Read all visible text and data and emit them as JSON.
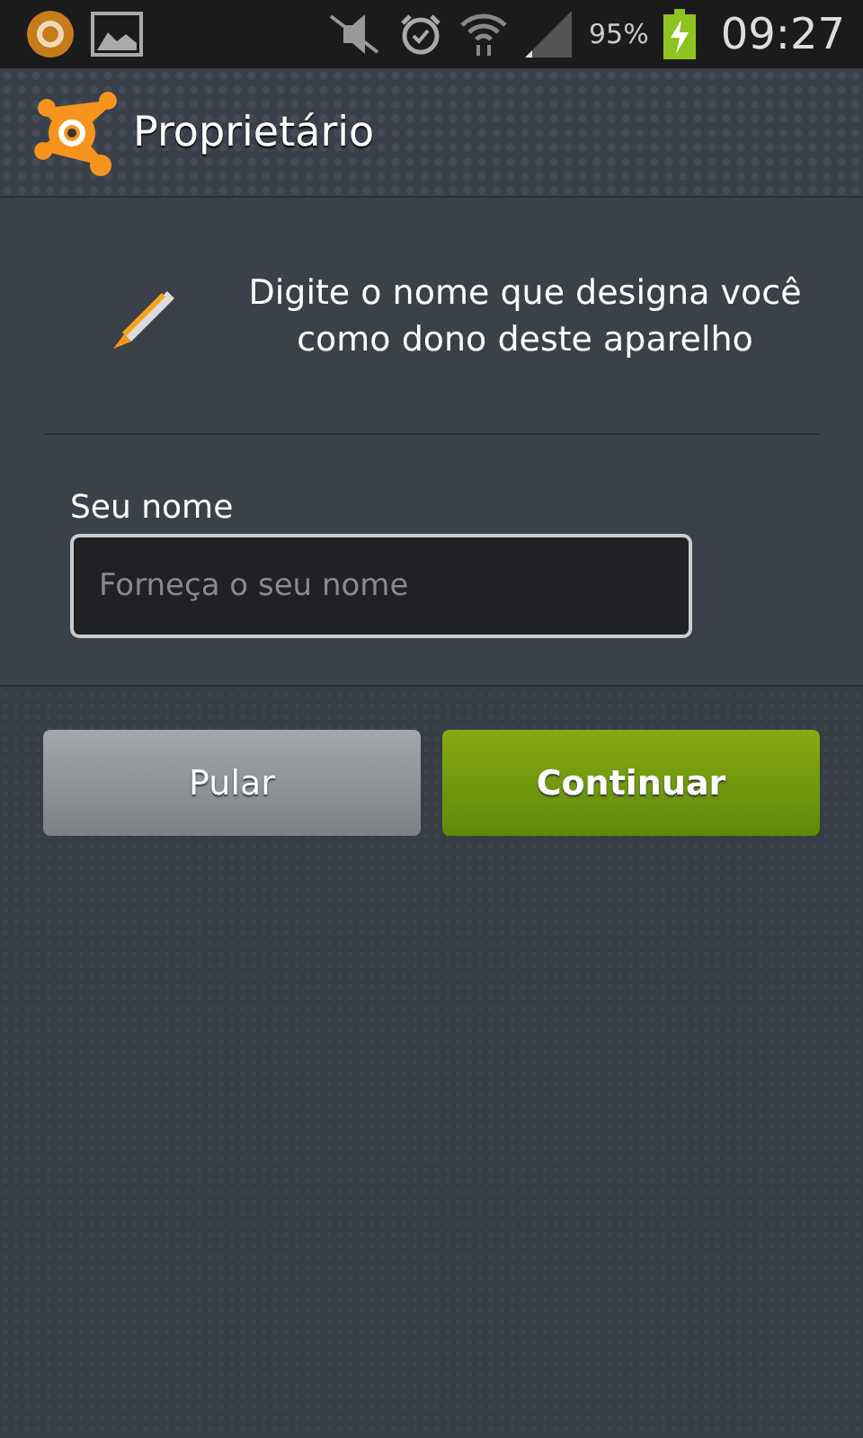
{
  "status_bar": {
    "battery_percent": "95%",
    "time": "09:27"
  },
  "app_bar": {
    "title": "Proprietário"
  },
  "form": {
    "instruction": "Digite o nome que designa você como dono deste aparelho",
    "field_label": "Seu nome",
    "name_field": {
      "placeholder": "Forneça o seu nome"
    }
  },
  "buttons": [
    {
      "label": "Pular",
      "kind": "secondary"
    },
    {
      "label": "Continuar",
      "kind": "primary"
    }
  ]
}
